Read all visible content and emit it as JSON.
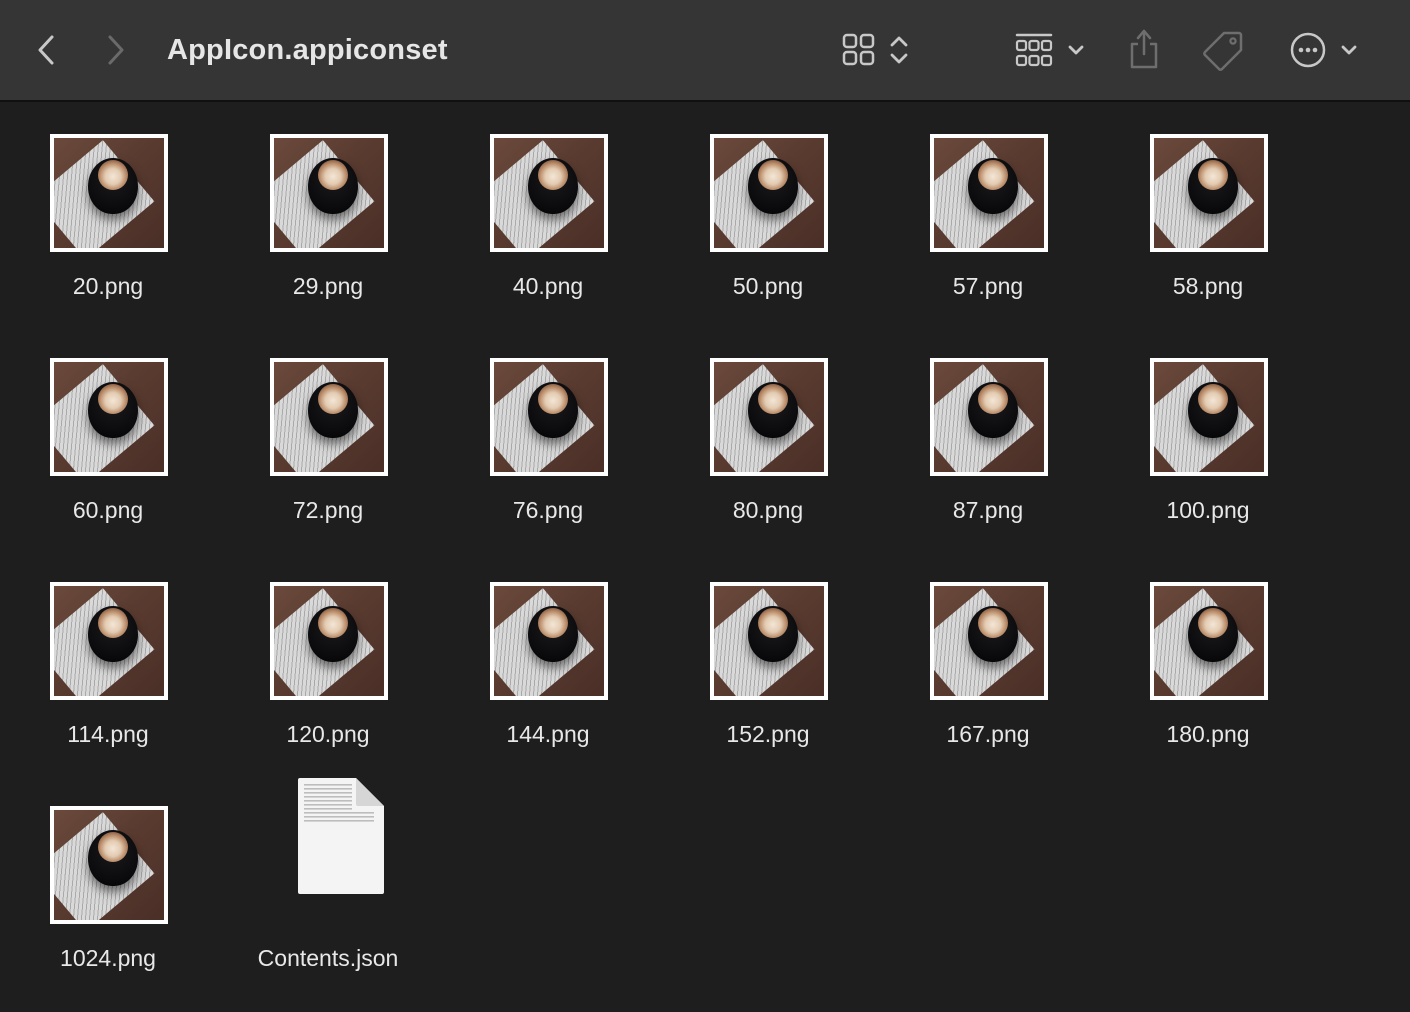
{
  "window": {
    "title": "AppIcon.appiconset"
  },
  "toolbar": {
    "icons": {
      "back": "chevron-left-icon",
      "forward": "chevron-right-icon",
      "view": "icon-grid-view-icon",
      "group": "group-by-icon",
      "share": "share-icon",
      "tag": "tag-icon",
      "more": "ellipsis-circle-icon"
    }
  },
  "files": [
    {
      "name": "20.png",
      "kind": "image"
    },
    {
      "name": "29.png",
      "kind": "image"
    },
    {
      "name": "40.png",
      "kind": "image"
    },
    {
      "name": "50.png",
      "kind": "image"
    },
    {
      "name": "57.png",
      "kind": "image"
    },
    {
      "name": "58.png",
      "kind": "image"
    },
    {
      "name": "60.png",
      "kind": "image"
    },
    {
      "name": "72.png",
      "kind": "image"
    },
    {
      "name": "76.png",
      "kind": "image"
    },
    {
      "name": "80.png",
      "kind": "image"
    },
    {
      "name": "87.png",
      "kind": "image"
    },
    {
      "name": "100.png",
      "kind": "image"
    },
    {
      "name": "114.png",
      "kind": "image"
    },
    {
      "name": "120.png",
      "kind": "image"
    },
    {
      "name": "144.png",
      "kind": "image"
    },
    {
      "name": "152.png",
      "kind": "image"
    },
    {
      "name": "167.png",
      "kind": "image"
    },
    {
      "name": "180.png",
      "kind": "image"
    },
    {
      "name": "1024.png",
      "kind": "image"
    },
    {
      "name": "Contents.json",
      "kind": "document"
    }
  ],
  "colors": {
    "window_bg": "#1e1e1e",
    "toolbar_bg": "#353535",
    "text": "#e8e8e8"
  }
}
